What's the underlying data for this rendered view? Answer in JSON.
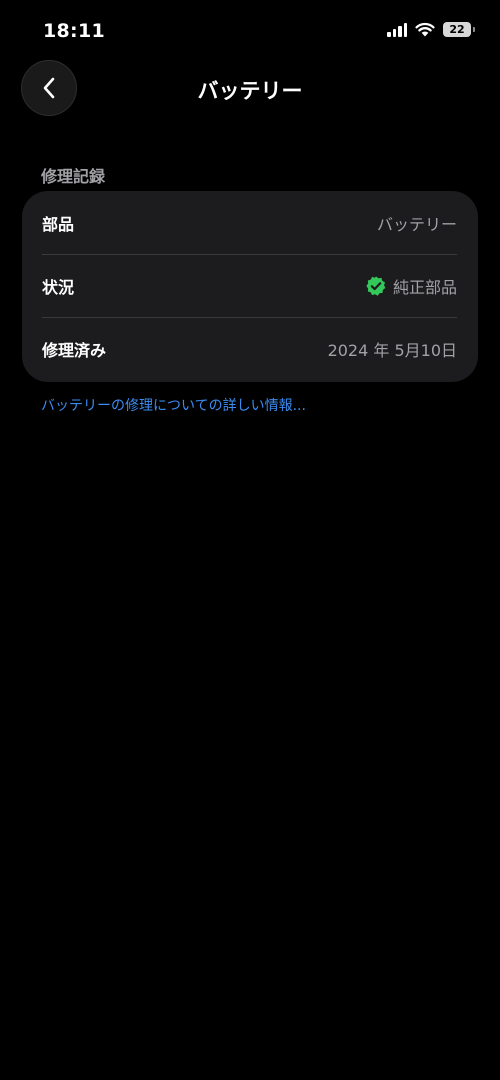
{
  "status_bar": {
    "time": "18:11",
    "battery_level": "22",
    "icons": [
      "signal-icon",
      "wifi-icon",
      "battery-icon"
    ]
  },
  "nav": {
    "title": "バッテリー",
    "back_icon": "chevron-left-icon"
  },
  "repair_record": {
    "section_title": "修理記録",
    "rows": [
      {
        "label": "部品",
        "value": "バッテリー"
      },
      {
        "label": "状況",
        "value": "純正部品",
        "icon": "verified-check-icon"
      },
      {
        "label": "修理済み",
        "value": "2024 年 5月10日"
      }
    ]
  },
  "link": {
    "text": "バッテリーの修理についての詳しい情報..."
  },
  "colors": {
    "background": "#000000",
    "card": "#1c1c1e",
    "secondary_text": "#a1a1a6",
    "link": "#3b8cf0",
    "verified": "#34c759"
  }
}
